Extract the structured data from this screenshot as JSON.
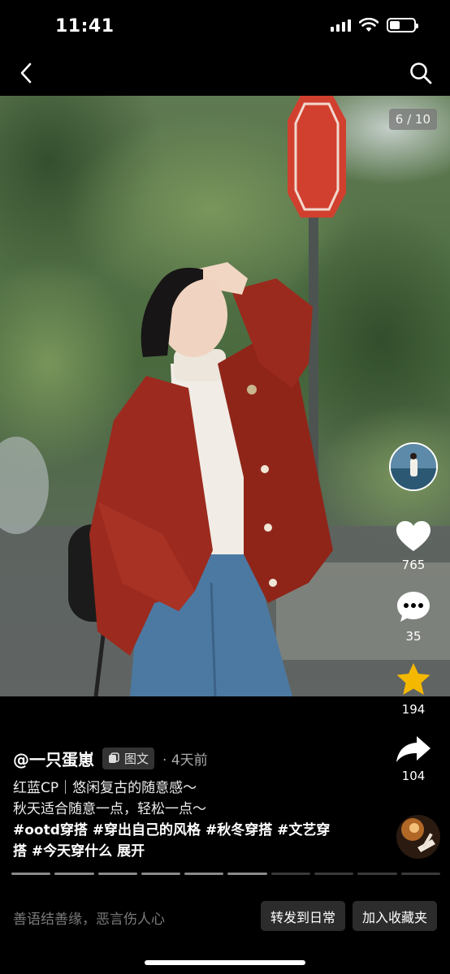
{
  "status_bar": {
    "time": "11:41"
  },
  "photo": {
    "page_indicator": "6 / 10"
  },
  "actions": {
    "like_count": "765",
    "comment_count": "35",
    "favorite_count": "194",
    "share_count": "104"
  },
  "post": {
    "author": "@一只蛋崽",
    "badge": "图文",
    "time_ago": "· 4天前",
    "caption_line1": "红蓝CP｜悠闲复古的随意感～",
    "caption_line2": "秋天适合随意一点，轻松一点～",
    "tags_line1": "#ootd穿搭 #穿出自己的风格 #秋冬穿搭 #文艺穿",
    "tags_line2": "搭 #今天穿什么",
    "expand_label": "展开"
  },
  "progress": {
    "total": 10,
    "current": 6
  },
  "comment_bar": {
    "placeholder": "善语结善缘，恶言伤人心",
    "repost_label": "转发到日常",
    "collect_label": "加入收藏夹"
  },
  "colors": {
    "background": "#000000",
    "favorite_star": "#f5b800",
    "cardigan_red": "#9c2a1e"
  }
}
